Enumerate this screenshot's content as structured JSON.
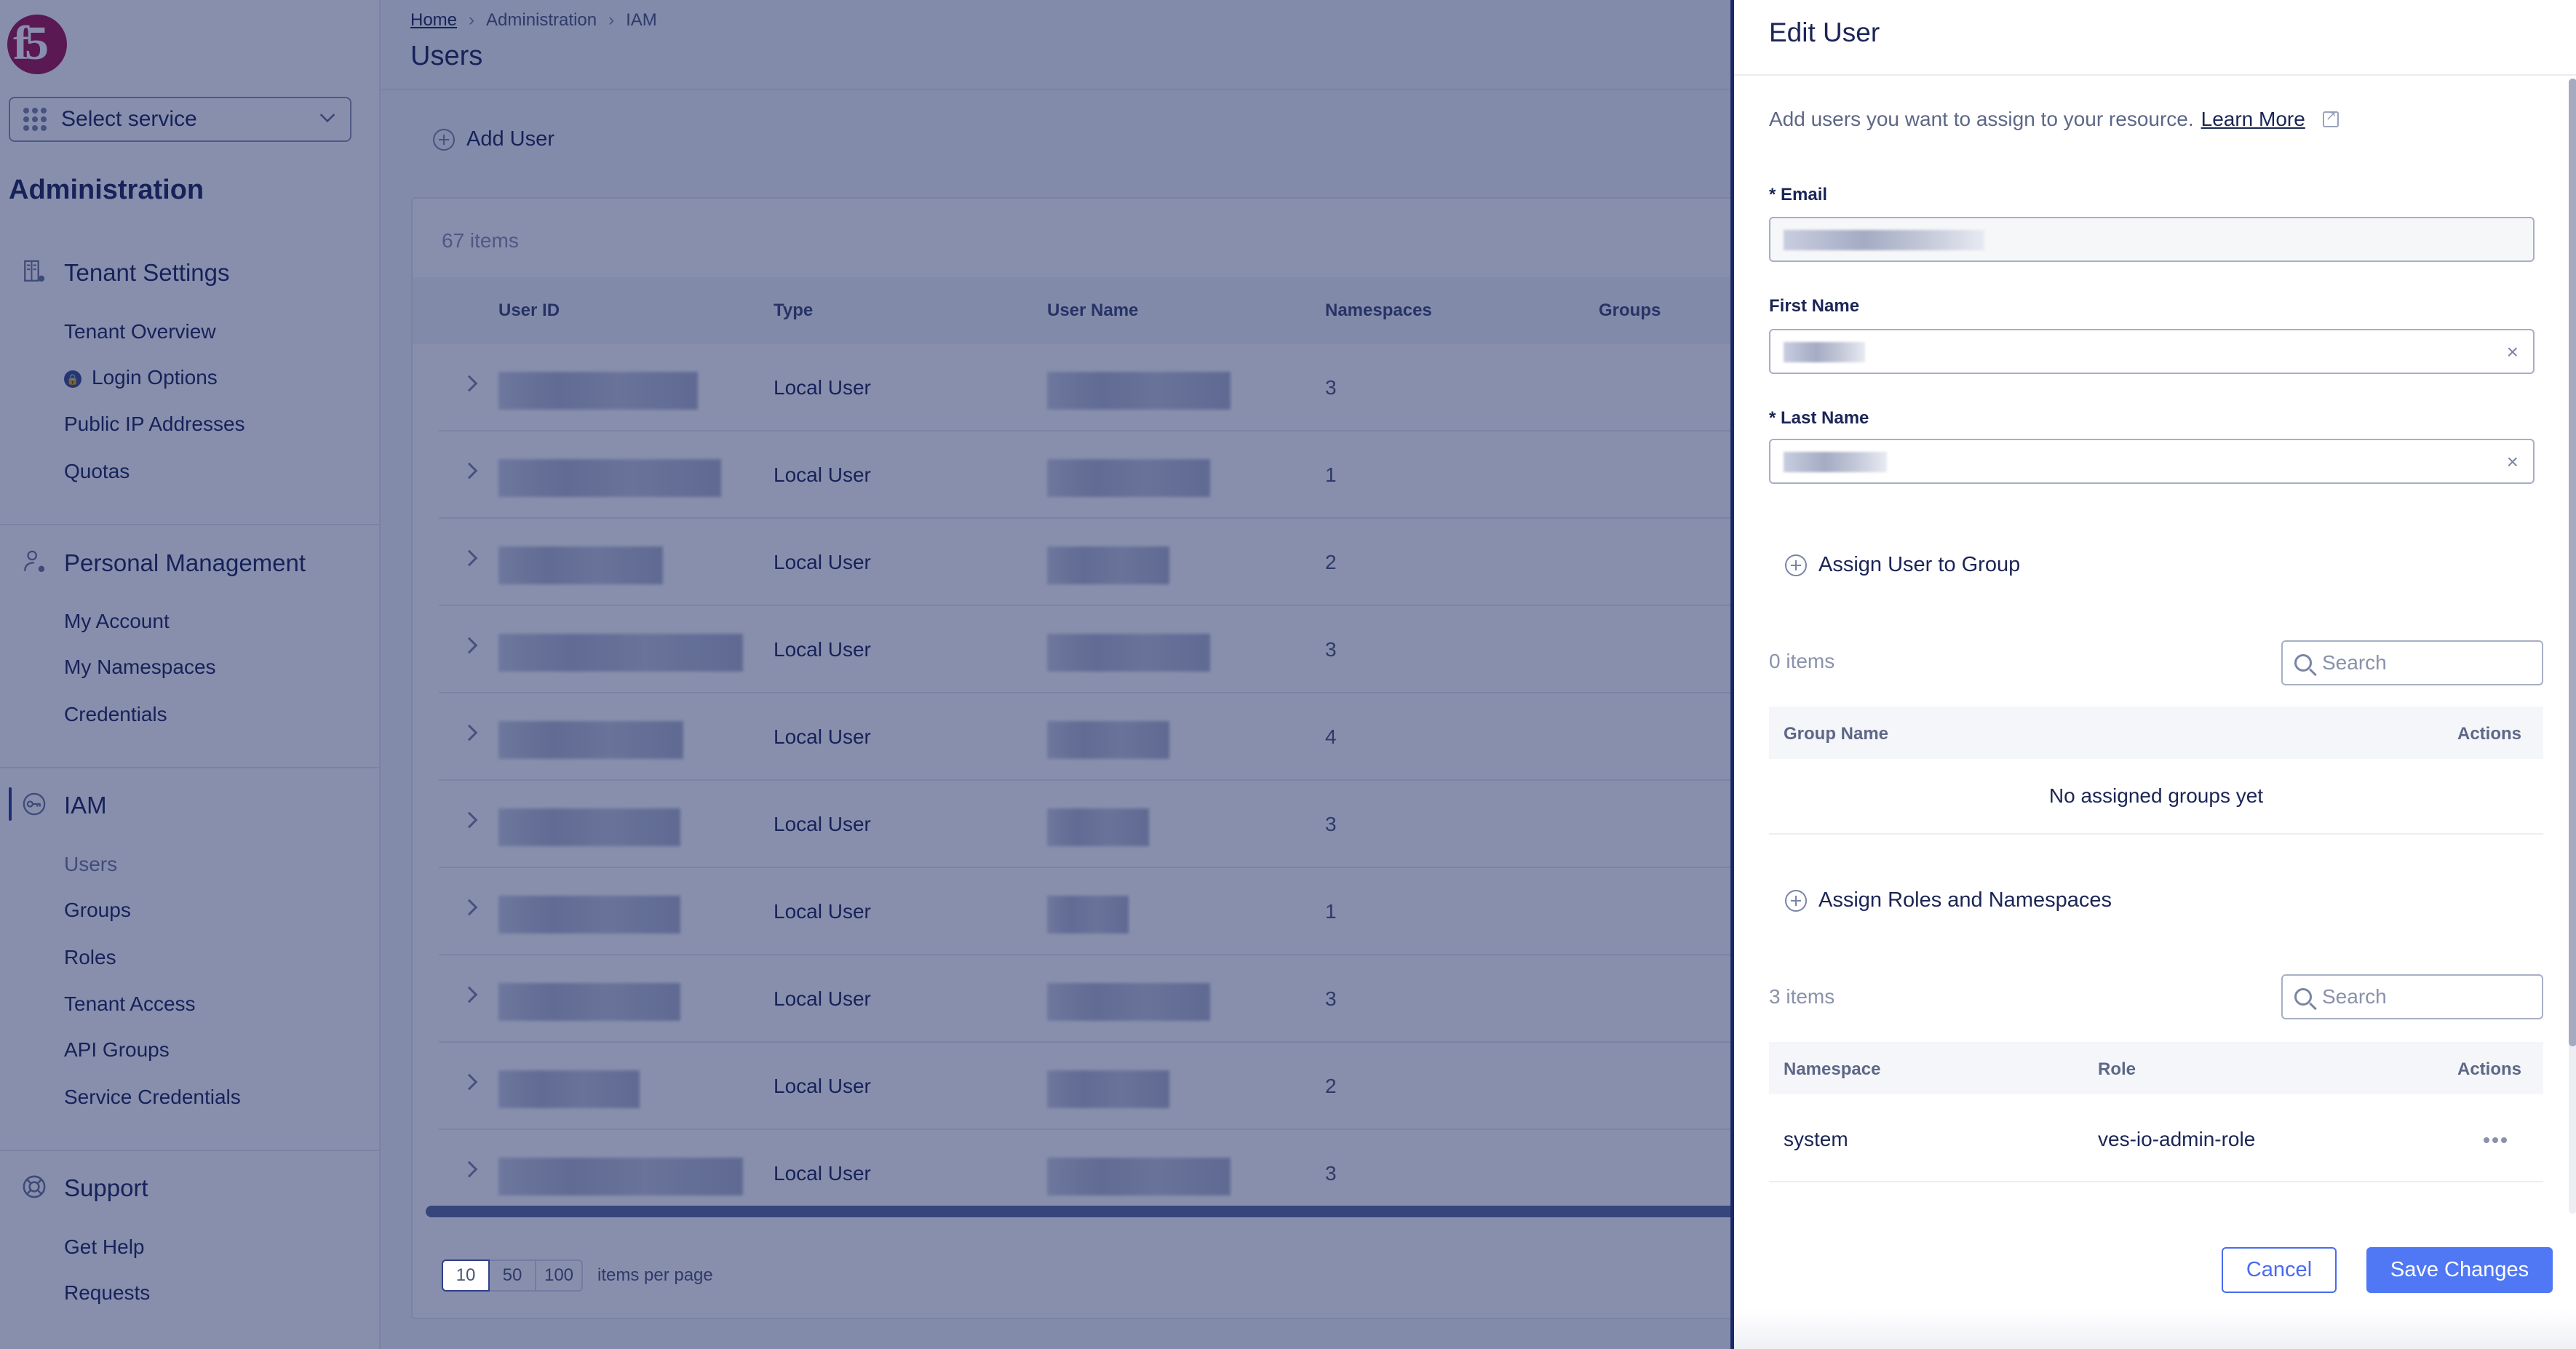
{
  "sidebar": {
    "logo": "f5",
    "service_select": {
      "label": "Select service",
      "icon": "grid-icon"
    },
    "title": "Administration",
    "sections": [
      {
        "heading": "Tenant Settings",
        "icon": "building-gear-icon",
        "items": [
          {
            "label": "Tenant Overview"
          },
          {
            "label": "Login Options",
            "icon": "lock-icon"
          },
          {
            "label": "Public IP Addresses"
          },
          {
            "label": "Quotas"
          }
        ]
      },
      {
        "heading": "Personal Management",
        "icon": "user-gear-icon",
        "items": [
          {
            "label": "My Account"
          },
          {
            "label": "My Namespaces"
          },
          {
            "label": "Credentials"
          }
        ]
      },
      {
        "heading": "IAM",
        "icon": "key-icon",
        "active": true,
        "items": [
          {
            "label": "Users",
            "active": true
          },
          {
            "label": "Groups"
          },
          {
            "label": "Roles"
          },
          {
            "label": "Tenant Access"
          },
          {
            "label": "API Groups"
          },
          {
            "label": "Service Credentials"
          }
        ]
      },
      {
        "heading": "Support",
        "icon": "lifebuoy-icon",
        "items": [
          {
            "label": "Get Help"
          },
          {
            "label": "Requests"
          }
        ]
      }
    ]
  },
  "main": {
    "breadcrumb": [
      "Home",
      "Administration",
      "IAM"
    ],
    "breadcrumb_sep": "›",
    "title": "Users",
    "add_button": "Add User",
    "items_count": "67 items",
    "columns": [
      "User ID",
      "Type",
      "User Name",
      "Namespaces",
      "Groups"
    ],
    "rows": [
      {
        "user_id": "[redacted]",
        "type": "Local User",
        "user_name": "[redacted]",
        "namespaces": "3",
        "groups": ""
      },
      {
        "user_id": "[redacted]",
        "type": "Local User",
        "user_name": "[redacted]",
        "namespaces": "1",
        "groups": ""
      },
      {
        "user_id": "[redacted]",
        "type": "Local User",
        "user_name": "[redacted]",
        "namespaces": "2",
        "groups": ""
      },
      {
        "user_id": "[redacted]",
        "type": "Local User",
        "user_name": "[redacted]",
        "namespaces": "3",
        "groups": ""
      },
      {
        "user_id": "[redacted]",
        "type": "Local User",
        "user_name": "[redacted]",
        "namespaces": "4",
        "groups": ""
      },
      {
        "user_id": "[redacted]",
        "type": "Local User",
        "user_name": "[redacted]",
        "namespaces": "3",
        "groups": ""
      },
      {
        "user_id": "[redacted]",
        "type": "Local User",
        "user_name": "[redacted]",
        "namespaces": "1",
        "groups": ""
      },
      {
        "user_id": "[redacted]",
        "type": "Local User",
        "user_name": "[redacted]",
        "namespaces": "3",
        "groups": ""
      },
      {
        "user_id": "[redacted]",
        "type": "Local User",
        "user_name": "[redacted]",
        "namespaces": "2",
        "groups": ""
      },
      {
        "user_id": "[redacted]",
        "type": "Local User",
        "user_name": "[redacted]",
        "namespaces": "3",
        "groups": ""
      }
    ],
    "pagination": {
      "options": [
        "10",
        "50",
        "100"
      ],
      "selected": "10",
      "label": "items per page"
    }
  },
  "drawer": {
    "title": "Edit User",
    "description": "Add users you want to assign to your resource.",
    "learn_more": "Learn More",
    "fields": {
      "email": {
        "label": "* Email",
        "value": "[redacted]",
        "disabled": true
      },
      "first_name": {
        "label": "First Name",
        "value": "[redacted]",
        "clear": "×"
      },
      "last_name": {
        "label": "* Last Name",
        "value": "[redacted]",
        "clear": "×"
      }
    },
    "groups": {
      "assign_label": "Assign User to Group",
      "count": "0 items",
      "search_placeholder": "Search",
      "columns": [
        "Group Name",
        "Actions"
      ],
      "empty_text": "No assigned groups yet"
    },
    "roles": {
      "assign_label": "Assign Roles and Namespaces",
      "count": "3 items",
      "search_placeholder": "Search",
      "columns": [
        "Namespace",
        "Role",
        "Actions"
      ],
      "rows": [
        {
          "namespace": "system",
          "role": "ves-io-admin-role"
        }
      ]
    },
    "buttons": {
      "cancel": "Cancel",
      "save": "Save Changes"
    }
  },
  "colors": {
    "accent": "#5078f5",
    "brand": "#a3124a",
    "text_primary": "#1b2556",
    "overlay": "#12205c"
  }
}
